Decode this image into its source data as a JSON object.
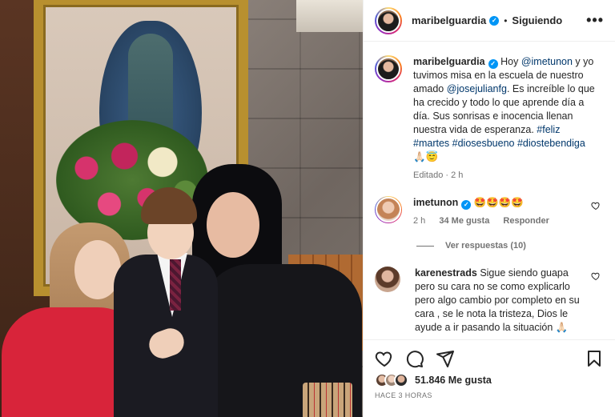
{
  "header": {
    "username": "maribelguardia",
    "separator": "•",
    "follow_status": "Siguiendo",
    "more": "•••"
  },
  "caption": {
    "username": "maribelguardia",
    "text_1": "Hoy ",
    "mention_1": "@imetunon",
    "text_2": " y yo tuvimos misa en la escuela de nuestro amado ",
    "mention_2": "@josejulianfg",
    "text_3": ". Es increíble lo que ha crecido y todo lo que aprende día a día. Sus sonrisas e inocencia llenan nuestra vida de esperanza. ",
    "hashtag_1": "#feliz",
    "hashtag_2": "#martes",
    "hashtag_3": "#diosesbueno",
    "hashtag_4": "#diostebendiga",
    "trailing_emoji": "🙏🏻😇",
    "meta": "Editado · 2 h"
  },
  "comments": [
    {
      "username": "imetunon",
      "text": "🤩🤩🤩🤩",
      "time": "2 h",
      "likes": "34 Me gusta",
      "reply": "Responder",
      "view_replies": "Ver respuestas (10)"
    },
    {
      "username": "karenestrads",
      "text": "Sigue siendo guapa pero su cara no se como explicarlo pero algo cambio por completo en su cara , se le nota la tristeza, Dios le ayude a ir pasando la situación 🙏🏻"
    }
  ],
  "footer": {
    "likes": "51.846 Me gusta",
    "time_ago": "HACE 3 HORAS"
  },
  "icons": {
    "verified": "verified-badge-icon",
    "heart": "heart-icon",
    "comment": "comment-icon",
    "share": "share-icon",
    "save": "bookmark-icon"
  },
  "colors": {
    "accent": "#0095f6",
    "link": "#00376b",
    "muted": "#737373",
    "text": "#262626"
  }
}
